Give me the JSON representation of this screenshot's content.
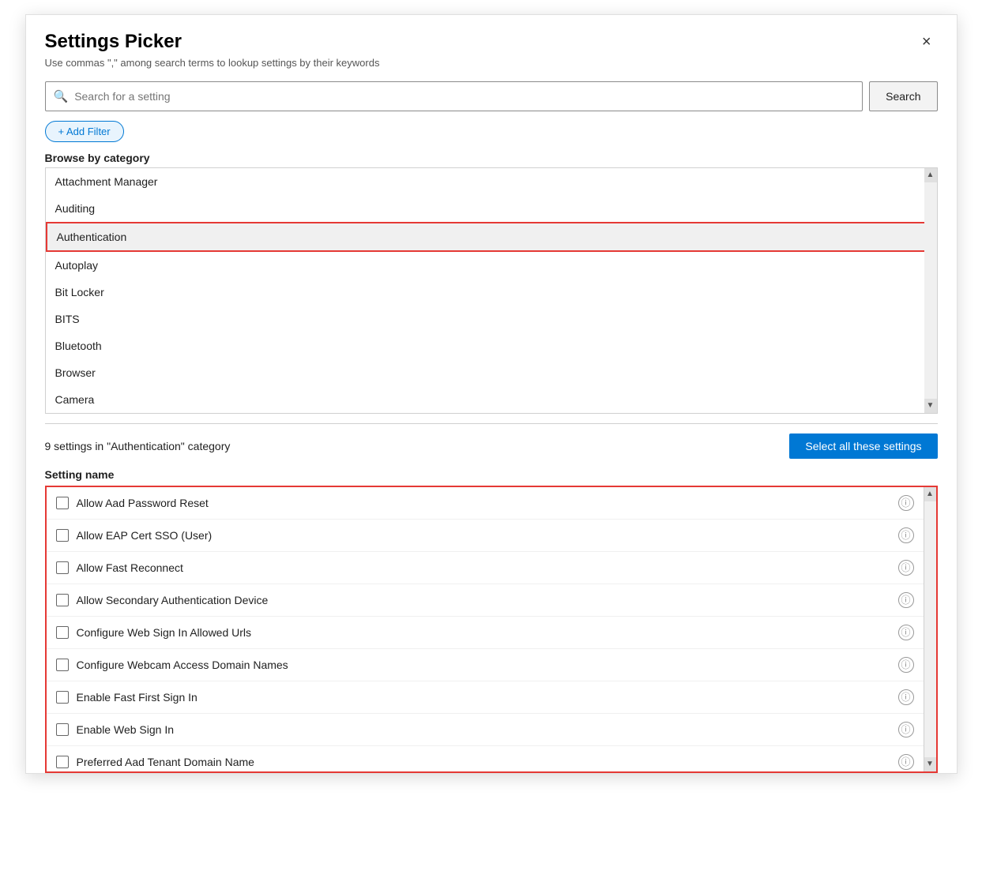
{
  "dialog": {
    "title": "Settings Picker",
    "subtitle": "Use commas \",\" among search terms to lookup settings by their keywords",
    "close_label": "×"
  },
  "search": {
    "placeholder": "Search for a setting",
    "button_label": "Search"
  },
  "filter": {
    "add_label": "+ Add Filter"
  },
  "browse": {
    "title": "Browse by category",
    "categories": [
      {
        "label": "Attachment Manager",
        "active": false
      },
      {
        "label": "Auditing",
        "active": false
      },
      {
        "label": "Authentication",
        "active": true
      },
      {
        "label": "Autoplay",
        "active": false
      },
      {
        "label": "Bit Locker",
        "active": false
      },
      {
        "label": "BITS",
        "active": false
      },
      {
        "label": "Bluetooth",
        "active": false
      },
      {
        "label": "Browser",
        "active": false
      },
      {
        "label": "Camera",
        "active": false
      }
    ]
  },
  "settings_section": {
    "count_label": "9 settings in \"Authentication\" category",
    "select_all_label": "Select all these settings",
    "column_header": "Setting name",
    "settings": [
      {
        "name": "Allow Aad Password Reset",
        "checked": false
      },
      {
        "name": "Allow EAP Cert SSO (User)",
        "checked": false
      },
      {
        "name": "Allow Fast Reconnect",
        "checked": false
      },
      {
        "name": "Allow Secondary Authentication Device",
        "checked": false
      },
      {
        "name": "Configure Web Sign In Allowed Urls",
        "checked": false
      },
      {
        "name": "Configure Webcam Access Domain Names",
        "checked": false
      },
      {
        "name": "Enable Fast First Sign In",
        "checked": false
      },
      {
        "name": "Enable Web Sign In",
        "checked": false
      },
      {
        "name": "Preferred Aad Tenant Domain Name",
        "checked": false
      }
    ]
  }
}
